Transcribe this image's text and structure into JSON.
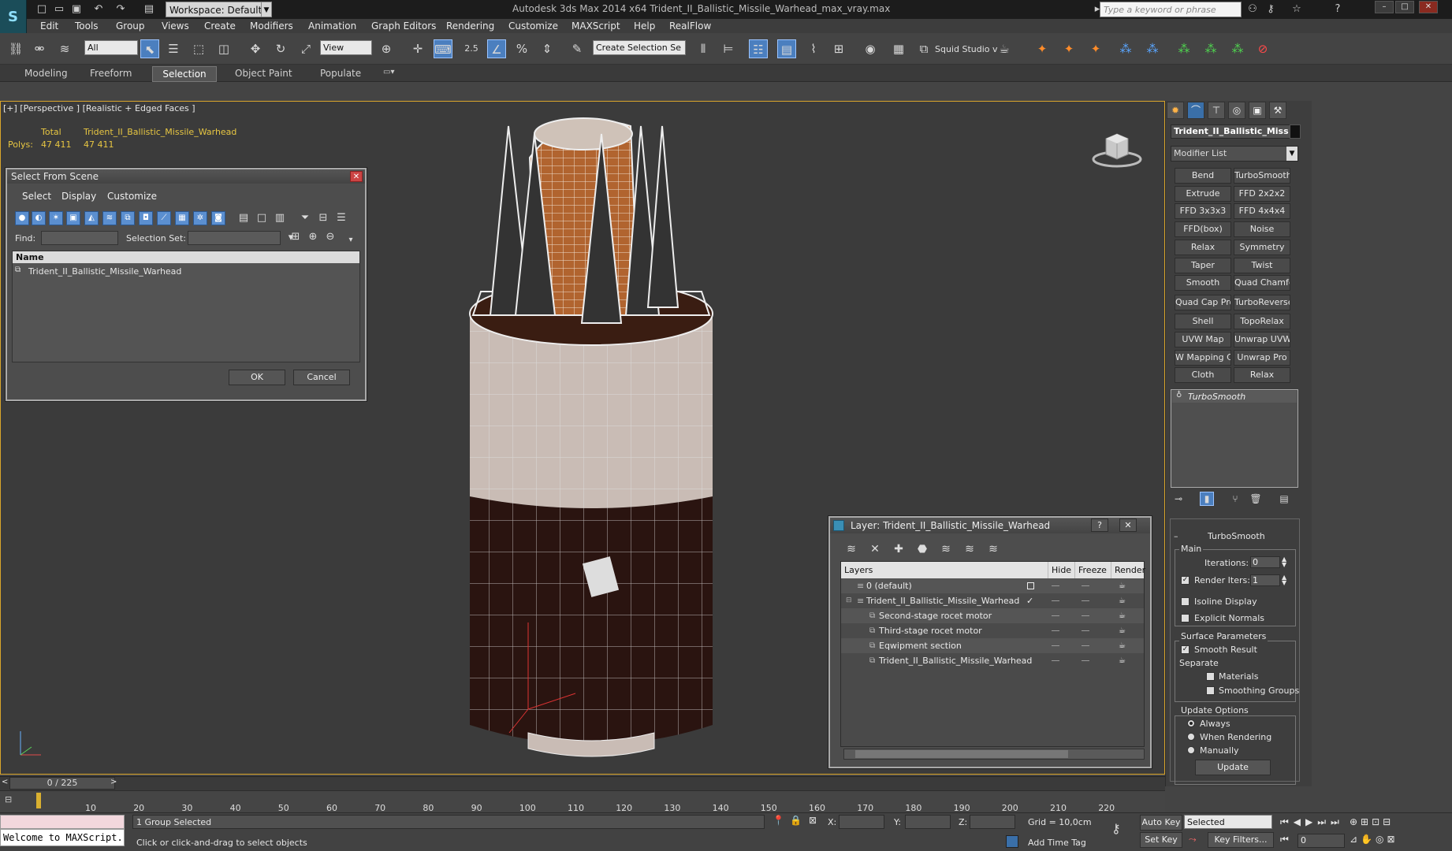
{
  "titlebar": {
    "workspace": "Workspace: Default",
    "app_title": "Autodesk 3ds Max  2014 x64      Trident_II_Ballistic_Missile_Warhead_max_vray.max",
    "search_placeholder": "Type a keyword or phrase"
  },
  "menubar": [
    "Edit",
    "Tools",
    "Group",
    "Views",
    "Create",
    "Modifiers",
    "Animation",
    "Graph Editors",
    "Rendering",
    "Customize",
    "MAXScript",
    "Help",
    "RealFlow"
  ],
  "toolbar": {
    "filter_value": "All",
    "refcoord_value": "View",
    "snap_value": "2.5",
    "selection_set_value": "Create Selection Se",
    "squid_label": "Squid Studio v"
  },
  "ribbon": {
    "tabs": [
      "Modeling",
      "Freeform",
      "Selection",
      "Object Paint",
      "Populate"
    ]
  },
  "viewport": {
    "label": "[+] [Perspective ] [Realistic + Edged Faces ]",
    "stats": {
      "total_label": "Total",
      "object_label": "Trident_II_Ballistic_Missile_Warhead",
      "polys_label": "Polys:",
      "total_polys": "47 411",
      "object_polys": "47 411"
    }
  },
  "select_from_scene": {
    "title": "Select From Scene",
    "menu": [
      "Select",
      "Display",
      "Customize"
    ],
    "find_label": "Find:",
    "selset_label": "Selection Set:",
    "column_name": "Name",
    "items": [
      "Trident_II_Ballistic_Missile_Warhead"
    ],
    "ok": "OK",
    "cancel": "Cancel"
  },
  "layer_dialog": {
    "title": "Layer: Trident_II_Ballistic_Missile_Warhead",
    "help": "?",
    "columns": {
      "layers": "Layers",
      "hide": "Hide",
      "freeze": "Freeze",
      "render": "Render"
    },
    "rows": [
      {
        "name": "0 (default)"
      },
      {
        "name": "Trident_II_Ballistic_Missile_Warhead"
      },
      {
        "name": "Second-stage rocet motor"
      },
      {
        "name": "Third-stage rocet motor"
      },
      {
        "name": "Eqwipment section"
      },
      {
        "name": "Trident_II_Ballistic_Missile_Warhead"
      }
    ]
  },
  "command_panel": {
    "object_name": "Trident_II_Ballistic_Miss",
    "modifier_list": "Modifier List",
    "modifiers": [
      [
        "Bend",
        "TurboSmooth"
      ],
      [
        "Extrude",
        "FFD 2x2x2"
      ],
      [
        "FFD 3x3x3",
        "FFD 4x4x4"
      ],
      [
        "FFD(box)",
        "Noise"
      ],
      [
        "Relax",
        "Symmetry"
      ],
      [
        "Taper",
        "Twist"
      ],
      [
        "Smooth",
        "Quad Chamfer"
      ],
      [
        "Quad Cap Pro",
        "TurboReverse"
      ],
      [
        "Shell",
        "TopoRelax"
      ],
      [
        "UVW Map",
        "Unwrap UVW"
      ],
      [
        "W Mapping Cle",
        "Unwrap Pro"
      ],
      [
        "Cloth",
        "Relax"
      ]
    ],
    "stack_item": "TurboSmooth",
    "rollout_title": "TurboSmooth",
    "main_label": "Main",
    "iterations_label": "Iterations:",
    "iterations_value": "0",
    "render_iters_label": "Render Iters:",
    "render_iters_value": "1",
    "isoline": "Isoline Display",
    "explicit_normals": "Explicit Normals",
    "surface_params": "Surface Parameters",
    "smooth_result": "Smooth Result",
    "separate": "Separate",
    "materials": "Materials",
    "smoothing_groups": "Smoothing Groups",
    "update_options": "Update Options",
    "always": "Always",
    "when_rendering": "When Rendering",
    "manually": "Manually",
    "update_button": "Update"
  },
  "timeline": {
    "frame": "0 / 225",
    "ticks": [
      "10",
      "20",
      "30",
      "40",
      "50",
      "60",
      "70",
      "80",
      "90",
      "100",
      "110",
      "120",
      "130",
      "140",
      "150",
      "160",
      "170",
      "180",
      "190",
      "200",
      "210",
      "220"
    ]
  },
  "status": {
    "maxscript": "Welcome to MAXScript.",
    "selected": "1 Group Selected",
    "prompt": "Click or click-and-drag to select objects",
    "x_label": "X:",
    "y_label": "Y:",
    "z_label": "Z:",
    "grid": "Grid = 10,0cm",
    "add_time_tag": "Add Time Tag",
    "auto_key": "Auto Key",
    "set_key": "Set Key",
    "selected_dropdown": "Selected",
    "key_filters": "Key Filters...",
    "frame_value": "0"
  }
}
